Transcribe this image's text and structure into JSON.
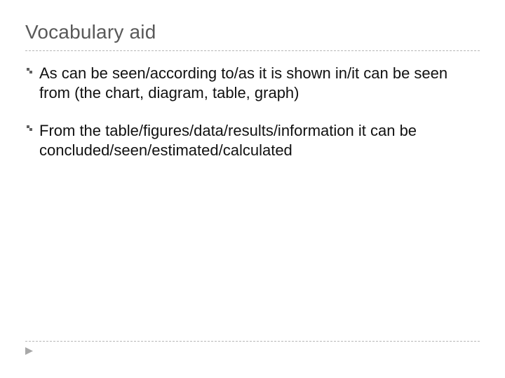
{
  "title": "Vocabulary aid",
  "bullets": [
    {
      "text": "As can be seen/according to/as it is shown in/it can be seen from (the chart, diagram, table, graph)"
    },
    {
      "text": "From the table/figures/data/results/information it can be concluded/seen/estimated/calculated"
    }
  ]
}
